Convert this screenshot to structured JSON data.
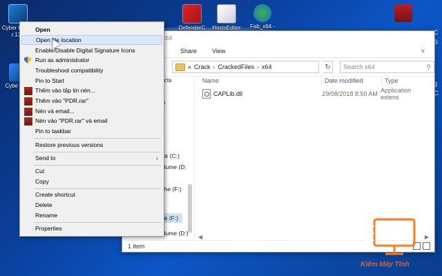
{
  "desktop": {
    "icons_left": [
      {
        "label": "Cyber Power r.17 (",
        "icon": "cyberlink-icon"
      },
      {
        "label": "Cybe Scre",
        "icon": "cyberlink-screen-icon"
      }
    ],
    "icons_top": [
      {
        "label": "DefenderC",
        "icon": "defender-control-icon"
      },
      {
        "label": "HostsEditor",
        "icon": "hosts-editor-icon"
      },
      {
        "label": "Fab_x64 -",
        "icon": "fab-icon"
      }
    ],
    "icons_right": [
      {
        "label": "",
        "icon": "winrar-icon"
      }
    ],
    "right_edge_labels": [
      "C",
      "S",
      "g",
      "C"
    ]
  },
  "explorer": {
    "title": "x64",
    "ribbon_tabs": [
      "Share",
      "View"
    ],
    "address": {
      "crumb_prefix": "«",
      "crumbs": [
        "Crack",
        "CrackedFiles",
        "x64"
      ]
    },
    "search_placeholder": "Search x64",
    "nav_items": [
      "ects",
      "p",
      "ts",
      "",
      "",
      "",
      "isk (C:)",
      "olume (D:",
      "",
      "ghe (F:)",
      "",
      "",
      "",
      "he (F:)",
      "olume (D:)"
    ],
    "columns": {
      "name": "Name",
      "date": "Date modified",
      "type": "Type"
    },
    "files": [
      {
        "name": "CAPLib.dll",
        "date": "29/08/2018 8:50 AM",
        "type": "Application extens"
      }
    ],
    "status": "1 item"
  },
  "context_menu": {
    "items": [
      {
        "label": "Open",
        "bold": true
      },
      {
        "label": "Open file location",
        "hover": true
      },
      {
        "label": "Enable/Disable Digital Signature Icons"
      },
      {
        "label": "Run as administrator",
        "icon": "shield-icon"
      },
      {
        "label": "Troubleshoot compatibility"
      },
      {
        "label": "Pin to Start"
      },
      {
        "label": "Thêm vào tập tin nén...",
        "icon": "winrar-icon"
      },
      {
        "label": "Thêm vào \"PDR.rar\"",
        "icon": "winrar-icon"
      },
      {
        "label": "Nén và email...",
        "icon": "winrar-icon"
      },
      {
        "label": "Nén vào \"PDR.rar\" và email",
        "icon": "winrar-icon"
      },
      {
        "label": "Pin to taskbar"
      },
      {
        "label": "Restore previous versions"
      },
      {
        "label": "Send to",
        "submenu": true
      },
      {
        "label": "Cut"
      },
      {
        "label": "Copy"
      },
      {
        "label": "Create shortcut"
      },
      {
        "label": "Delete"
      },
      {
        "label": "Rename"
      },
      {
        "label": "Properties"
      }
    ]
  },
  "watermark": {
    "text": "Kiếm Máy Tính"
  }
}
